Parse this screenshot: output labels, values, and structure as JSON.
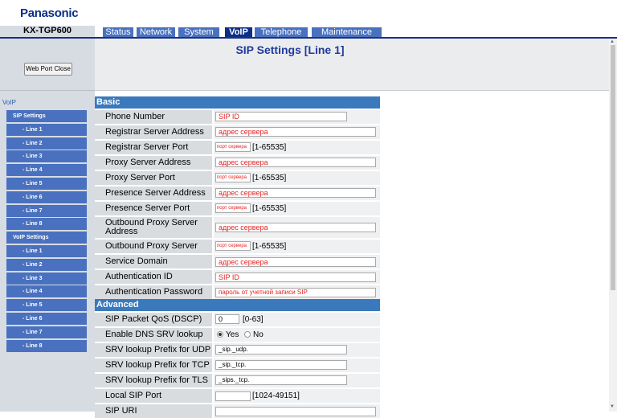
{
  "brand": "Panasonic",
  "model": "KX-TGP600",
  "tabs": [
    "Status",
    "Network",
    "System",
    "VoIP",
    "Telephone",
    "Maintenance"
  ],
  "active_tab": "VoIP",
  "web_port_close": "Web Port Close",
  "sidebar": {
    "section": "VoIP",
    "items": [
      {
        "label": "SIP Settings",
        "type": "head"
      },
      {
        "label": "- Line 1",
        "type": "sub"
      },
      {
        "label": "- Line 2",
        "type": "sub"
      },
      {
        "label": "- Line 3",
        "type": "sub"
      },
      {
        "label": "- Line 4",
        "type": "sub"
      },
      {
        "label": "- Line 5",
        "type": "sub"
      },
      {
        "label": "- Line 6",
        "type": "sub"
      },
      {
        "label": "- Line 7",
        "type": "sub"
      },
      {
        "label": "- Line 8",
        "type": "sub"
      },
      {
        "label": "VoIP Settings",
        "type": "head"
      },
      {
        "label": "- Line 1",
        "type": "sub"
      },
      {
        "label": "- Line 2",
        "type": "sub"
      },
      {
        "label": "- Line 3",
        "type": "sub"
      },
      {
        "label": "- Line 4",
        "type": "sub"
      },
      {
        "label": "- Line 5",
        "type": "sub"
      },
      {
        "label": "- Line 6",
        "type": "sub"
      },
      {
        "label": "- Line 7",
        "type": "sub"
      },
      {
        "label": "- Line 8",
        "type": "sub"
      }
    ]
  },
  "page_title": "SIP Settings [Line 1]",
  "sections": {
    "basic": "Basic",
    "advanced": "Advanced"
  },
  "basic": {
    "phone_number": {
      "label": "Phone Number",
      "value": "SIP ID"
    },
    "registrar_addr": {
      "label": "Registrar Server Address",
      "value": "адрес сервера"
    },
    "registrar_port": {
      "label": "Registrar Server Port",
      "value": "порт сервера",
      "range": "[1-65535]"
    },
    "proxy_addr": {
      "label": "Proxy Server Address",
      "value": "адрес сервера"
    },
    "proxy_port": {
      "label": "Proxy Server Port",
      "value": "порт сервера",
      "range": "[1-65535]"
    },
    "presence_addr": {
      "label": "Presence Server Address",
      "value": "адрес сервера"
    },
    "presence_port": {
      "label": "Presence Server Port",
      "value": "порт сервера",
      "range": "[1-65535]"
    },
    "outbound_addr": {
      "label": "Outbound Proxy Server Address",
      "value": "адрес сервера"
    },
    "outbound_port": {
      "label": "Outbound Proxy Server Port",
      "value": "порт сервера",
      "range": "[1-65535]"
    },
    "service_domain": {
      "label": "Service Domain",
      "value": "адрес сервера"
    },
    "auth_id": {
      "label": "Authentication ID",
      "value": "SIP ID"
    },
    "auth_pw": {
      "label": "Authentication Password",
      "value": "пароль от учетной записи SIP"
    }
  },
  "advanced": {
    "qos": {
      "label": "SIP Packet QoS (DSCP)",
      "value": "0",
      "range": "[0-63]"
    },
    "dns_srv": {
      "label": "Enable DNS SRV lookup",
      "yes": "Yes",
      "no": "No",
      "selected": "Yes"
    },
    "srv_udp": {
      "label": "SRV lookup Prefix for UDP",
      "value": "_sip._udp."
    },
    "srv_tcp": {
      "label": "SRV lookup Prefix for TCP",
      "value": "_sip._tcp."
    },
    "srv_tls": {
      "label": "SRV lookup Prefix for TLS",
      "value": "_sips._tcp."
    },
    "local_port": {
      "label": "Local SIP Port",
      "value": "",
      "range": "[1024-49151]"
    },
    "sip_uri": {
      "label": "SIP URI",
      "value": ""
    }
  }
}
